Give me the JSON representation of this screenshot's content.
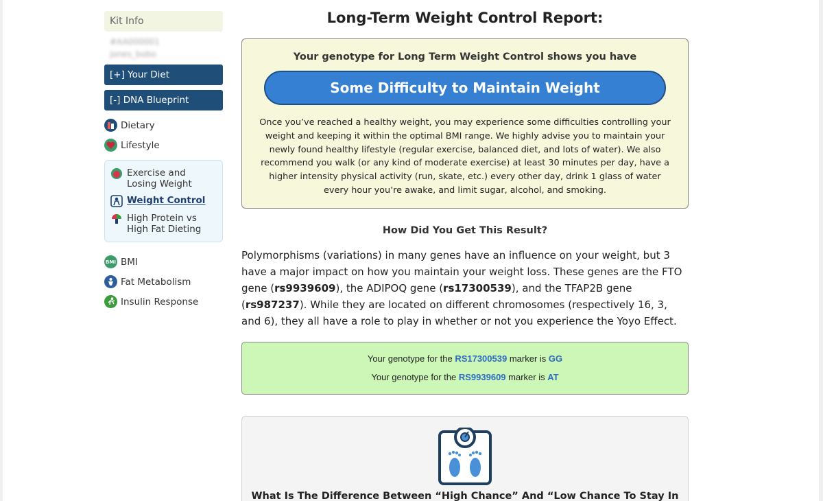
{
  "sidebar": {
    "kit_info": "Kit Info",
    "kit_id": "#AA000001",
    "kit_user": "jones_bobo",
    "your_diet": "[+] Your Diet",
    "dna_blueprint": "[-] DNA Blueprint",
    "items_top": [
      {
        "label": "Dietary",
        "icon": "dietary-icon",
        "color": "#1f4e79"
      },
      {
        "label": "Lifestyle",
        "icon": "heart-icon",
        "color": "#b8263a"
      }
    ],
    "sub_items": [
      {
        "label": "Exercise and Losing Weight",
        "icon": "apple-icon"
      },
      {
        "label": "Weight Control",
        "icon": "person-icon",
        "active": true
      },
      {
        "label": "High Protein vs High Fat Dieting",
        "icon": "food-icon"
      }
    ],
    "items_bottom": [
      {
        "label": "BMI",
        "icon": "bmi-icon",
        "color": "#3b9c6a"
      },
      {
        "label": "Fat Metabolism",
        "icon": "metabolism-icon",
        "color": "#2d5d9a"
      },
      {
        "label": "Insulin Response",
        "icon": "runner-icon",
        "color": "#3b9c3b"
      }
    ]
  },
  "main": {
    "title": "Long-Term Weight Control Report:",
    "genotype_intro": "Your genotype for Long Term Weight Control shows you have",
    "result": "Some Difficulty to Maintain Weight",
    "result_desc": "Once you’ve reached a healthy weight, you may experience some difficulties controlling your weight and keeping it within the optimal BMI range. We highly advise you to maintain your newly found healthy lifestyle (regular exercise, balanced diet, and lots of water). We also recommend you walk (or any kind of moderate exercise) at least 30 minutes per day, have a higher intensity physical activity (run, skate, etc.) every other day, drink 1 glass of water every hour you’re awake, and limit sugar, alcohol, and smoking.",
    "how_title": "How Did You Get This Result?",
    "para": {
      "t1": "Polymorphisms (variations) in many genes have an influence on your weight, but 3 have a major impact on how you maintain your weight loss. These genes are the FTO gene (",
      "rs1": "rs9939609",
      "t2": "), the ADIPOQ gene (",
      "rs2": "rs17300539",
      "t3": "), and the TFAP2B gene (",
      "rs3": "rs987237",
      "t4": "). While they are located on different chromosomes (respectively 16, 3, and 6), they all have a role to play in whether or not you experience the Yoyo Effect."
    },
    "markers": [
      {
        "prefix": "Your genotype for the",
        "marker": "RS17300539",
        "mid": "marker is",
        "genotype": "GG"
      },
      {
        "prefix": "Your genotype for the",
        "marker": "RS9939609",
        "mid": "marker is",
        "genotype": "AT"
      }
    ],
    "bottom_title": "What Is The Difference Between “High Chance” And “Low Chance To Stay In Shape”?"
  },
  "colors": {
    "nav_blue": "#1f4e79",
    "pill_blue": "#3580d3",
    "result_bg": "#f7f7dc",
    "marker_bg": "#ccf7b6",
    "link_blue": "#2e6bc4"
  }
}
